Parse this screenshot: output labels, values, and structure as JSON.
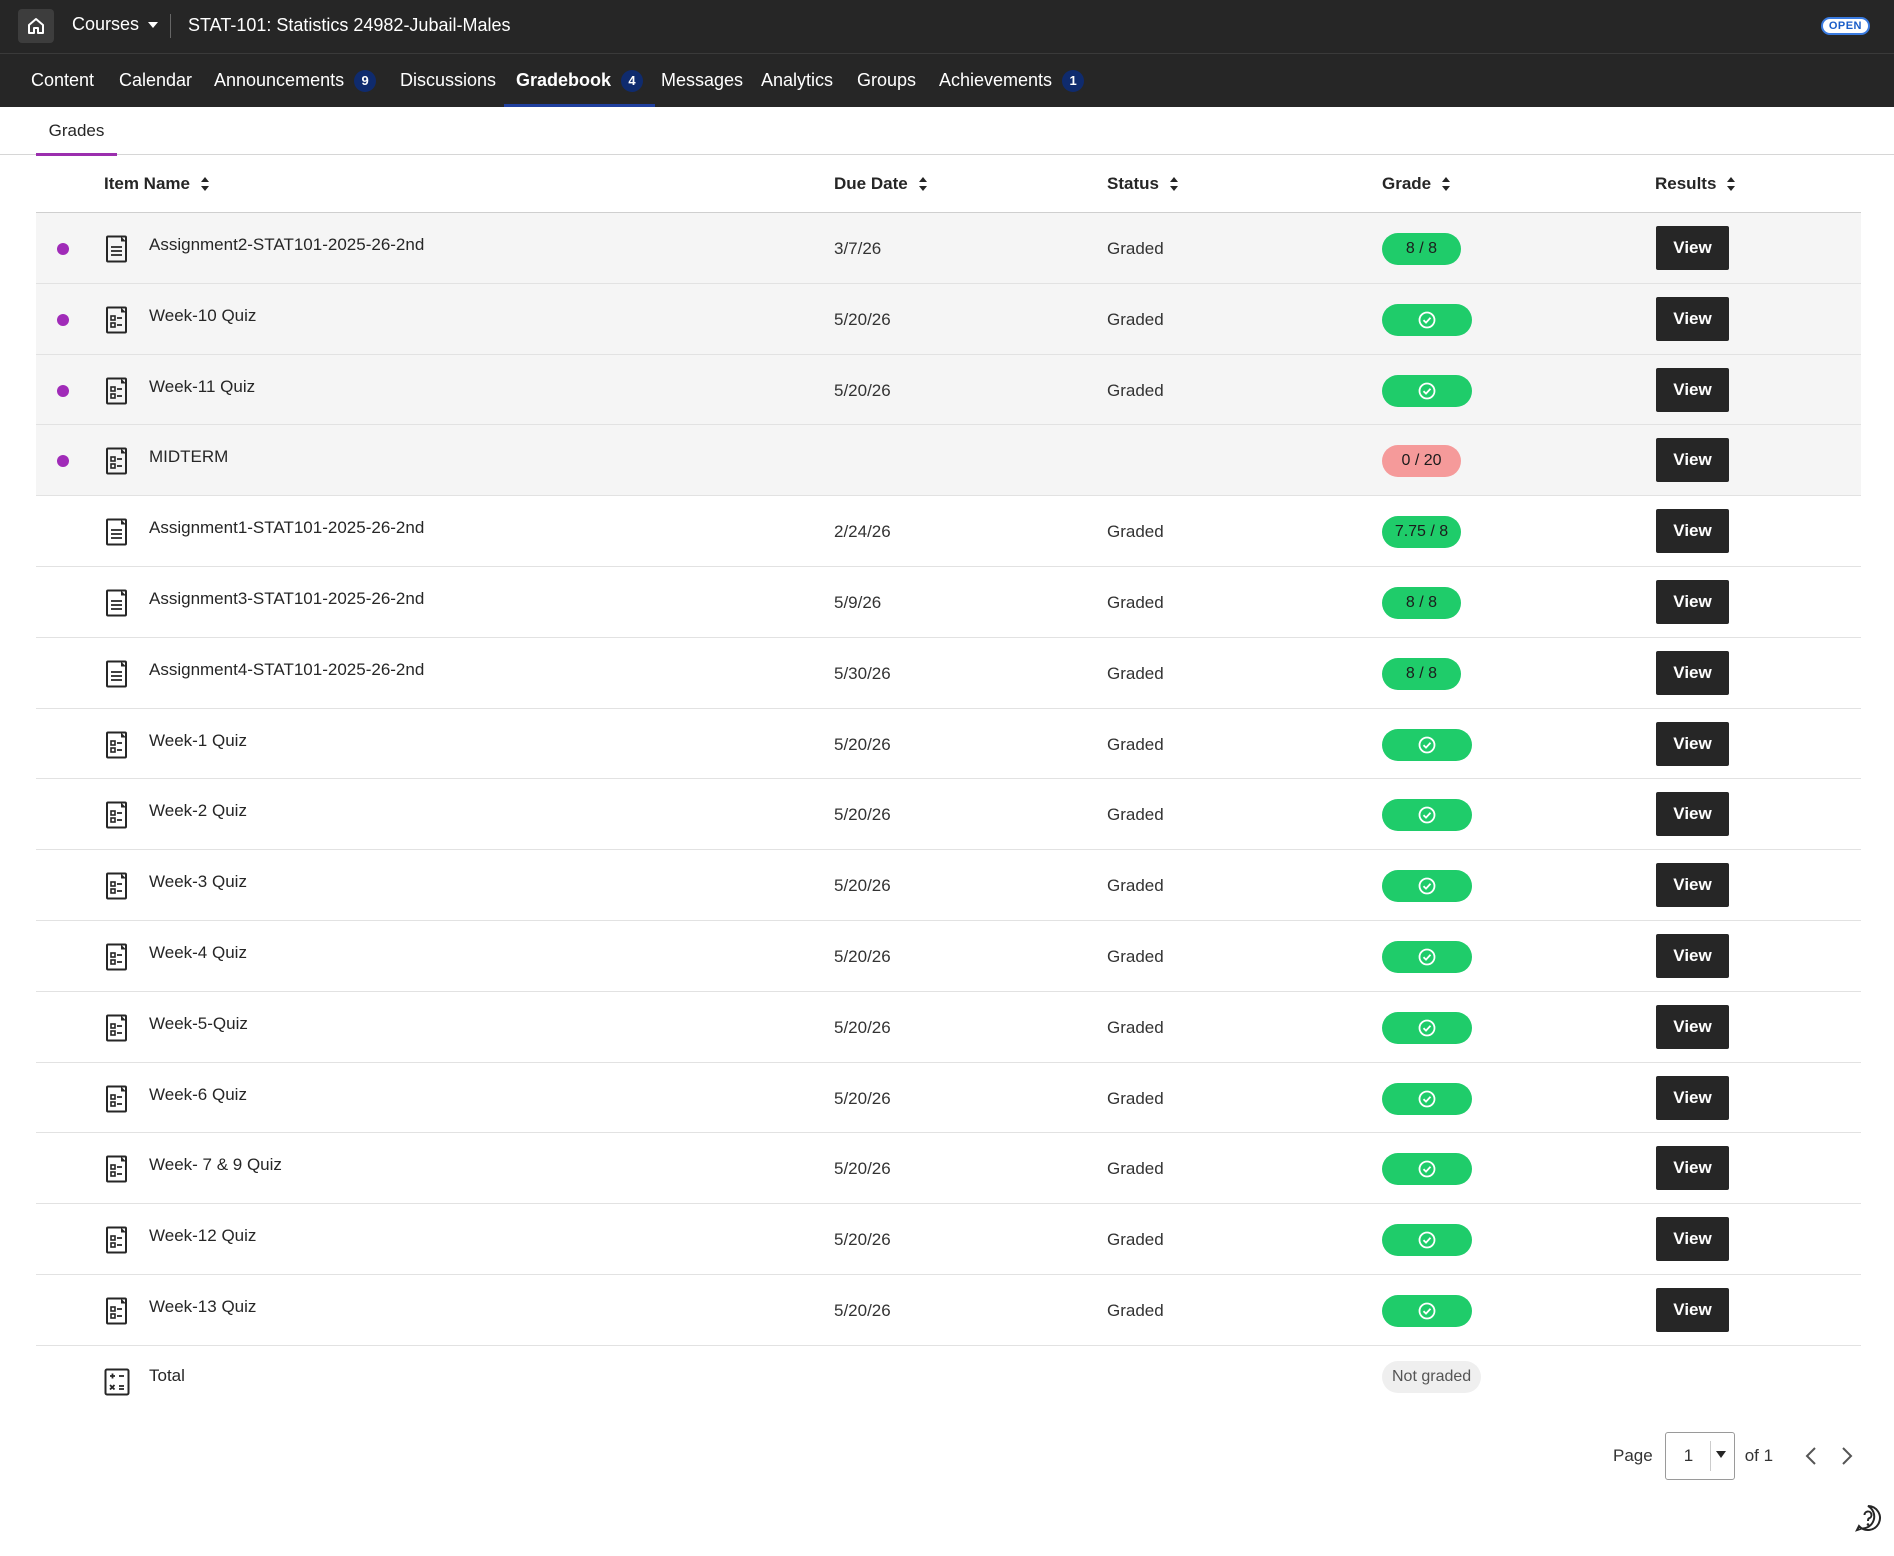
{
  "topbar": {
    "home_icon": "home-icon",
    "courses_label": "Courses",
    "course_title": "STAT-101: Statistics 24982-Jubail-Males",
    "open_badge": "OPEN"
  },
  "nav": {
    "items": [
      {
        "label": "Content",
        "badge": null
      },
      {
        "label": "Calendar",
        "badge": null
      },
      {
        "label": "Announcements",
        "badge": "9"
      },
      {
        "label": "Discussions",
        "badge": null
      },
      {
        "label": "Gradebook",
        "badge": "4",
        "active": true
      },
      {
        "label": "Messages",
        "badge": null
      },
      {
        "label": "Analytics",
        "badge": null
      },
      {
        "label": "Groups",
        "badge": null
      },
      {
        "label": "Achievements",
        "badge": "1"
      }
    ]
  },
  "subtabs": {
    "grades": "Grades"
  },
  "table": {
    "headers": {
      "item_name": "Item Name",
      "due_date": "Due Date",
      "status": "Status",
      "grade": "Grade",
      "results": "Results"
    },
    "rows": [
      {
        "name": "Assignment2-STAT101-2025-26-2nd",
        "icon": "document-icon",
        "due": "3/7/26",
        "status": "Graded",
        "grade_type": "score",
        "grade": "8 / 8",
        "unread": true
      },
      {
        "name": "Week-10 Quiz",
        "icon": "quiz-icon",
        "due": "5/20/26",
        "status": "Graded",
        "grade_type": "check",
        "grade": "",
        "unread": true
      },
      {
        "name": "Week-11 Quiz",
        "icon": "quiz-icon",
        "due": "5/20/26",
        "status": "Graded",
        "grade_type": "check",
        "grade": "",
        "unread": true
      },
      {
        "name": "MIDTERM",
        "icon": "quiz-icon",
        "due": "",
        "status": "",
        "grade_type": "fail",
        "grade": "0 / 20",
        "unread": true
      },
      {
        "name": "Assignment1-STAT101-2025-26-2nd",
        "icon": "document-icon",
        "due": "2/24/26",
        "status": "Graded",
        "grade_type": "score",
        "grade": "7.75 / 8",
        "unread": false
      },
      {
        "name": "Assignment3-STAT101-2025-26-2nd",
        "icon": "document-icon",
        "due": "5/9/26",
        "status": "Graded",
        "grade_type": "score",
        "grade": "8 / 8",
        "unread": false
      },
      {
        "name": "Assignment4-STAT101-2025-26-2nd",
        "icon": "document-icon",
        "due": "5/30/26",
        "status": "Graded",
        "grade_type": "score",
        "grade": "8 / 8",
        "unread": false
      },
      {
        "name": "Week-1 Quiz",
        "icon": "quiz-icon",
        "due": "5/20/26",
        "status": "Graded",
        "grade_type": "check",
        "grade": "",
        "unread": false
      },
      {
        "name": "Week-2 Quiz",
        "icon": "quiz-icon",
        "due": "5/20/26",
        "status": "Graded",
        "grade_type": "check",
        "grade": "",
        "unread": false
      },
      {
        "name": "Week-3 Quiz",
        "icon": "quiz-icon",
        "due": "5/20/26",
        "status": "Graded",
        "grade_type": "check",
        "grade": "",
        "unread": false
      },
      {
        "name": "Week-4 Quiz",
        "icon": "quiz-icon",
        "due": "5/20/26",
        "status": "Graded",
        "grade_type": "check",
        "grade": "",
        "unread": false
      },
      {
        "name": "Week-5-Quiz",
        "icon": "quiz-icon",
        "due": "5/20/26",
        "status": "Graded",
        "grade_type": "check",
        "grade": "",
        "unread": false
      },
      {
        "name": "Week-6 Quiz",
        "icon": "quiz-icon",
        "due": "5/20/26",
        "status": "Graded",
        "grade_type": "check",
        "grade": "",
        "unread": false
      },
      {
        "name": "Week- 7 & 9 Quiz",
        "icon": "quiz-icon",
        "due": "5/20/26",
        "status": "Graded",
        "grade_type": "check",
        "grade": "",
        "unread": false
      },
      {
        "name": "Week-12 Quiz",
        "icon": "quiz-icon",
        "due": "5/20/26",
        "status": "Graded",
        "grade_type": "check",
        "grade": "",
        "unread": false
      },
      {
        "name": "Week-13 Quiz",
        "icon": "quiz-icon",
        "due": "5/20/26",
        "status": "Graded",
        "grade_type": "check",
        "grade": "",
        "unread": false
      }
    ],
    "view_label": "View",
    "total": {
      "name": "Total",
      "icon": "calculator-icon",
      "grade": "Not graded"
    }
  },
  "pager": {
    "label": "Page",
    "current": "1",
    "of_label": "of 1"
  },
  "colors": {
    "topbar_bg": "#262626",
    "active_tab_underline": "#9b2fae",
    "unread_dot": "#a02bb8",
    "grade_pass": "#1fcc6a",
    "grade_fail": "#f59a9a",
    "nav_badge": "#0f2b6e"
  }
}
